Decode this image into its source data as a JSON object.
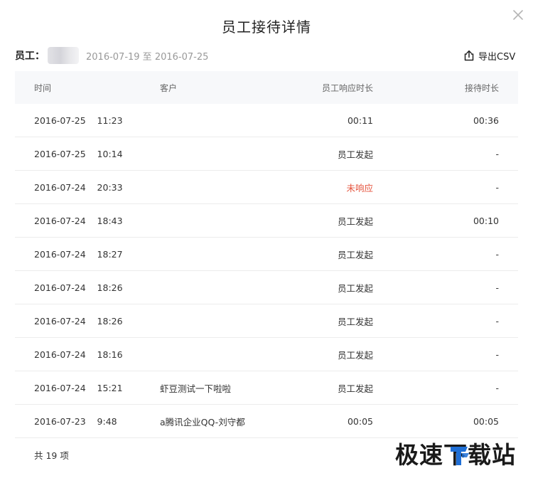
{
  "dialog": {
    "title": "员工接待详情",
    "close_icon": "close-icon"
  },
  "info": {
    "employee_label": "员工：",
    "date_range": "2016-07-19 至 2016-07-25"
  },
  "export": {
    "icon": "share-export-icon",
    "label": "导出CSV"
  },
  "table": {
    "headers": {
      "time": "时间",
      "client": "客户",
      "response": "员工响应时长",
      "duration": "接待时长"
    },
    "rows": [
      {
        "time": "2016-07-25    11:23",
        "client": "",
        "response": "00:11",
        "duration": "00:36",
        "response_color": ""
      },
      {
        "time": "2016-07-25    10:14",
        "client": "",
        "response": "员工发起",
        "duration": "-",
        "response_color": ""
      },
      {
        "time": "2016-07-24    20:33",
        "client": "",
        "response": "未响应",
        "duration": "-",
        "response_color": "#e5533d"
      },
      {
        "time": "2016-07-24    18:43",
        "client": "",
        "response": "员工发起",
        "duration": "00:10",
        "response_color": ""
      },
      {
        "time": "2016-07-24    18:27",
        "client": "",
        "response": "员工发起",
        "duration": "-",
        "response_color": ""
      },
      {
        "time": "2016-07-24    18:26",
        "client": "",
        "response": "员工发起",
        "duration": "-",
        "response_color": ""
      },
      {
        "time": "2016-07-24    18:26",
        "client": "",
        "response": "员工发起",
        "duration": "-",
        "response_color": ""
      },
      {
        "time": "2016-07-24    18:16",
        "client": "",
        "response": "员工发起",
        "duration": "-",
        "response_color": ""
      },
      {
        "time": "2016-07-24    15:21",
        "client": "虾豆测试一下啦啦",
        "response": "员工发起",
        "duration": "-",
        "response_color": ""
      },
      {
        "time": "2016-07-23    9:48",
        "client": "a腾讯企业QQ-刘守都",
        "response": "00:05",
        "duration": "00:05",
        "response_color": ""
      }
    ]
  },
  "footer": {
    "total": "共 19 项"
  },
  "watermark": {
    "text": "极速下载站"
  }
}
